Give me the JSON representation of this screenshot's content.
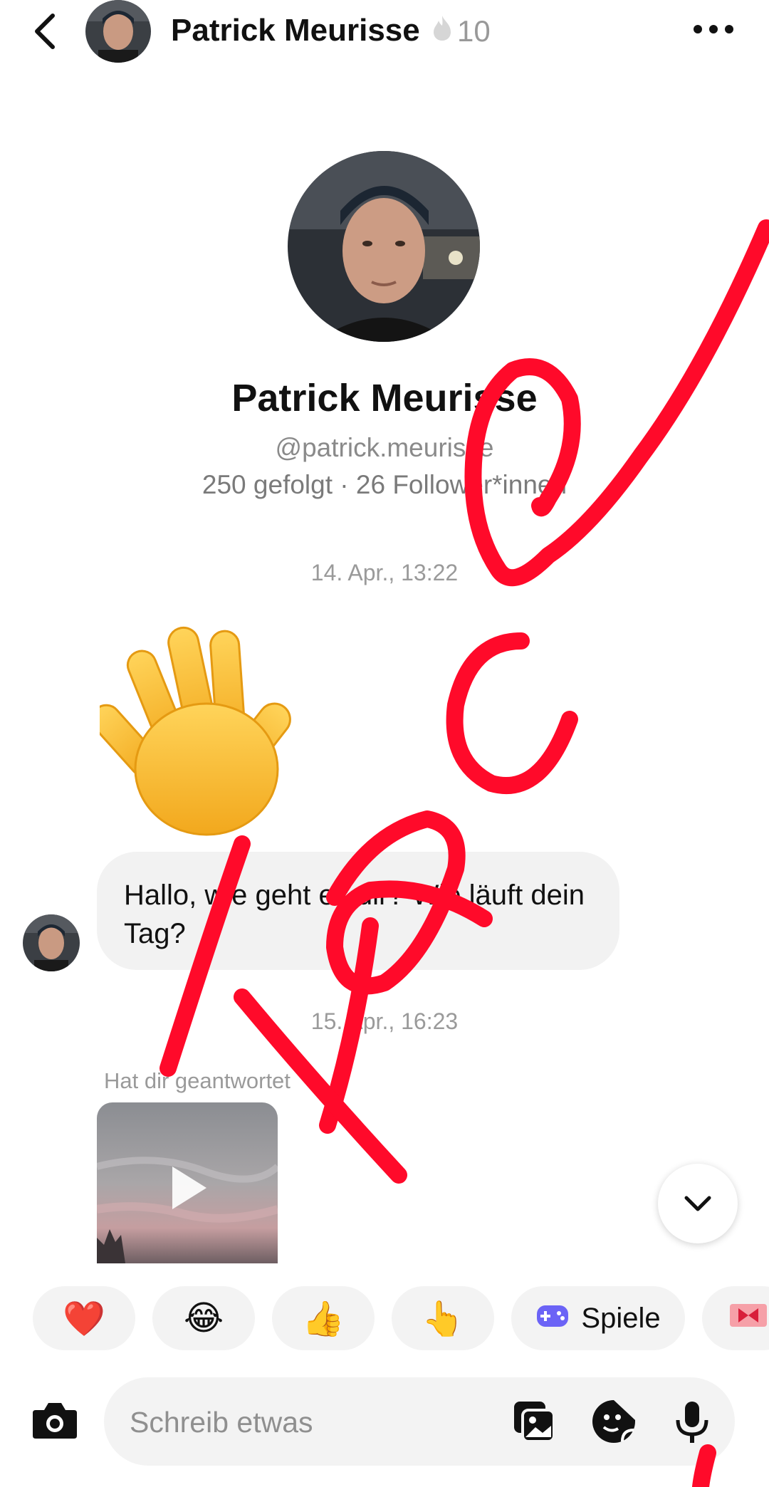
{
  "header": {
    "contact_name": "Patrick Meurisse",
    "streak_count": "10",
    "back_icon": "chevron-left-icon",
    "more_icon": "more-horizontal-icon",
    "streak_icon": "flame-icon"
  },
  "profile": {
    "name": "Patrick Meurisse",
    "handle": "@patrick.meurisse",
    "stats": "250 gefolgt · 26 Follower*innen"
  },
  "messages": {
    "timestamp_1": "14. Apr., 13:22",
    "wave_emoji": "👋",
    "text_message": "Hallo, wie geht es dir? Wie läuft dein Tag?",
    "timestamp_2": "15. Apr., 16:23",
    "replied_label": "Hat dir geantwortet"
  },
  "quick_reactions": {
    "heart": "❤️",
    "laugh": "😂",
    "thumbs_up": "👍",
    "pointing": "👆",
    "games_label": "Spiele"
  },
  "composer": {
    "placeholder": "Schreib etwas",
    "camera_icon": "camera-icon",
    "gallery_icon": "image-gallery-icon",
    "sticker_icon": "sticker-icon",
    "mic_icon": "microphone-icon"
  },
  "colors": {
    "scribble": "#ff0a2a",
    "bubble_bg": "#f2f2f2",
    "muted_text": "#8a8a8a",
    "games_icon": "#6b63f6"
  }
}
